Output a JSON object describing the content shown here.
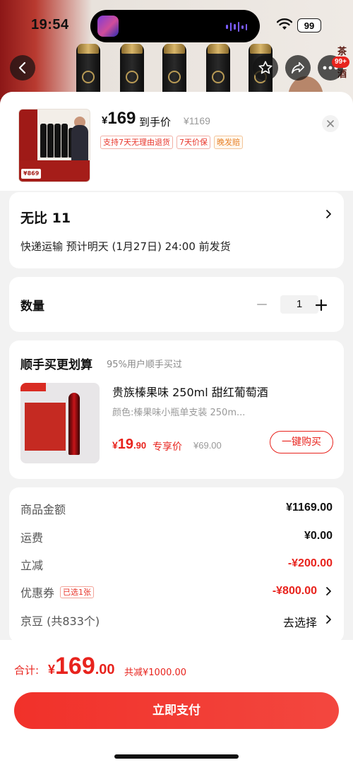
{
  "status_bar": {
    "time": "19:54",
    "battery": "99"
  },
  "nav": {
    "badge": "99+"
  },
  "backdrop": {
    "side_text": "茶葡酒"
  },
  "product": {
    "thumb_price": "¥869",
    "price_currency": "¥",
    "price": "169",
    "price_label": "到手价",
    "original_price": "¥1169",
    "tags": [
      "支持7天无理由退货",
      "7天价保",
      "晚发赔"
    ]
  },
  "shipping": {
    "title": "无比 11",
    "description": "快递运输 预计明天 (1月27日) 24:00 前发货"
  },
  "quantity": {
    "label": "数量",
    "value": "1"
  },
  "upsell": {
    "title": "顺手买更划算",
    "subtitle": "95%用户顺手买过",
    "item": {
      "name": "贵族榛果味 250ml 甜红葡萄酒",
      "spec": "颜色:榛果味小瓶单支装 250m...",
      "price_currency": "¥",
      "price_int": "19",
      "price_dec": ".90",
      "price_label": "专享价",
      "original_price": "¥69.00",
      "buy_button": "一键购买"
    }
  },
  "summary": {
    "goods_label": "商品金额",
    "goods_value": "¥1169.00",
    "shipping_label": "运费",
    "shipping_value": "¥0.00",
    "discount_label": "立减",
    "discount_value": "-¥200.00",
    "coupon_label": "优惠券",
    "coupon_tag": "已选1张",
    "coupon_value": "-¥800.00",
    "jingdou_label": "京豆 (共833个)",
    "jingdou_value": "去选择"
  },
  "footer": {
    "total_label": "合计:",
    "total_currency": "¥",
    "total_int": "169",
    "total_dec": ".00",
    "total_reduce": "共减¥1000.00",
    "pay_button": "立即支付"
  },
  "colors": {
    "accent": "#e8231d",
    "price_text": "#111111",
    "muted": "#999999"
  }
}
